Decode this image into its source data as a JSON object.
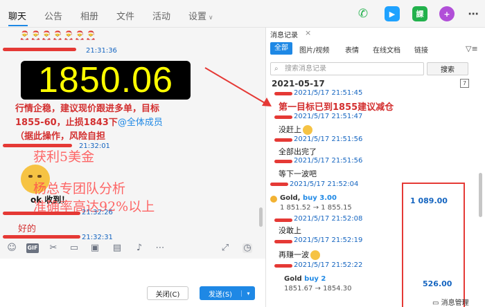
{
  "tabs": [
    {
      "label": "聊天"
    },
    {
      "label": "公告"
    },
    {
      "label": "相册"
    },
    {
      "label": "文件"
    },
    {
      "label": "活动"
    },
    {
      "label": "设置"
    }
  ],
  "chat": {
    "emoji_strip": "🎅🎅🎅🎅🎅🎅🎅",
    "time1": "21:31:36",
    "big_price": "1850.06",
    "signal_line1": "行情企稳，建议现价跟进多单，目标",
    "signal_line2": "1855-60，止损1843下",
    "mention": "@全体成员",
    "signal_line3": "（据此操作，风险自担",
    "time2": "21:32:01",
    "overlay1": "获利5美金",
    "overlay2": "杨总专团队分析",
    "overlay3": "准确率高达92%以上",
    "ok_text": "ok 收到！",
    "time3": "21:32:26",
    "reply": "好的",
    "time4": "21:32:31"
  },
  "buttons": {
    "close": "关闭(C)",
    "send": "发送(S)",
    "send_dropdown": "▾"
  },
  "history": {
    "title": "消息记录",
    "filters": [
      "全部",
      "图片/视频",
      "表情",
      "在线文档",
      "链接"
    ],
    "search_placeholder": "搜索消息记录",
    "search_button": "搜索",
    "date": "2021-05-17",
    "target_msg": "第一目标已到1855建议减仓",
    "messages": [
      {
        "time": "2021/5/17 21:51:45"
      },
      {
        "time": "2021/5/17 21:51:47",
        "text": "没赶上"
      },
      {
        "time": "2021/5/17 21:51:56",
        "text": "全部出完了"
      },
      {
        "time": "2021/5/17 21:51:56",
        "text": "等下一波吧"
      },
      {
        "time": "2021/5/17 21:52:04"
      },
      {
        "time": "2021/5/17 21:52:08",
        "text": "没敢上"
      },
      {
        "time": "2021/5/17 21:52:19",
        "text": "再赚一波"
      },
      {
        "time": "2021/5/17 21:52:22"
      }
    ],
    "card1": {
      "asset": "Gold,",
      "side": "buy 3.00",
      "range": "1 851.52 → 1 855.15",
      "profit": "1 089.00"
    },
    "card2": {
      "asset": "Gold",
      "side": "buy 2",
      "range": "1851.67 → 1854.30",
      "profit": "526.00"
    },
    "footer": "消息管理"
  },
  "colors": {
    "accent": "#1e88e5",
    "alert": "#e53935",
    "price": "#ffff00"
  }
}
